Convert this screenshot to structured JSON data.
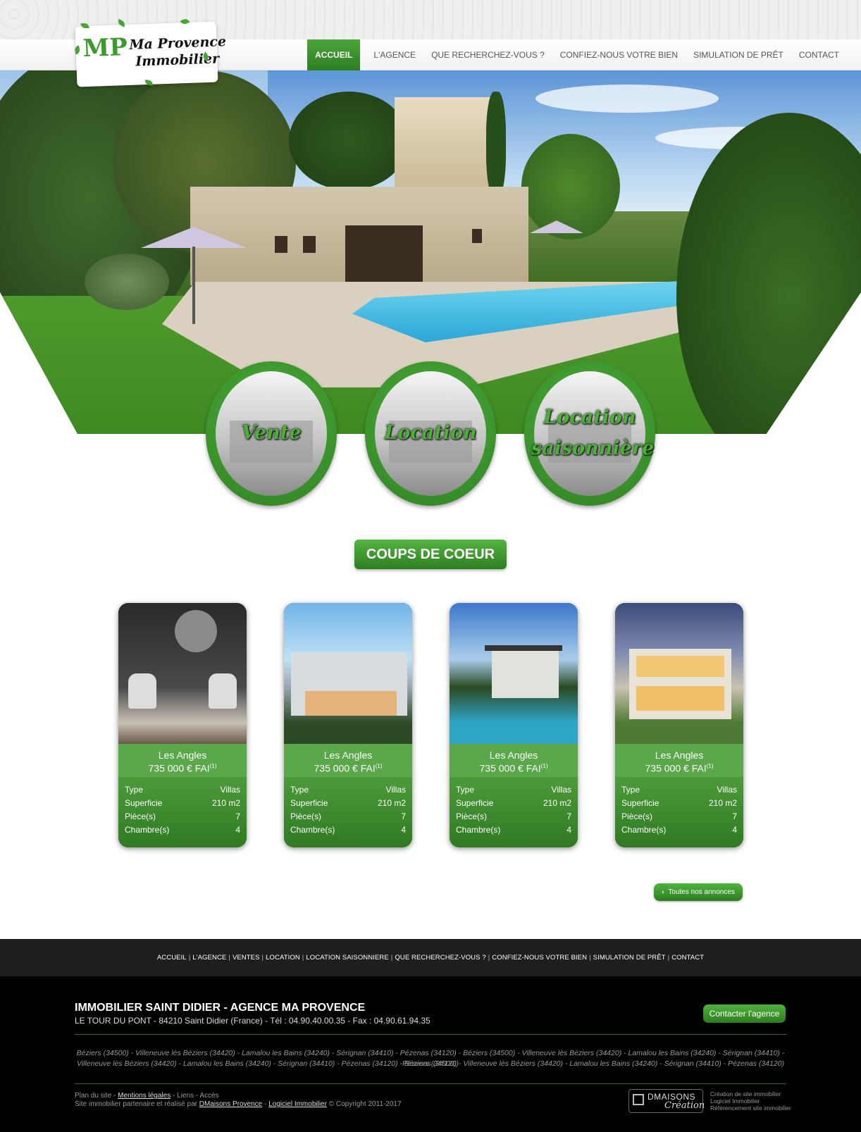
{
  "logo": {
    "line1": "Ma Provence",
    "line2": "Immobilier",
    "mark": "MP"
  },
  "nav": {
    "items": [
      "ACCUEIL",
      "L'AGENCE",
      "QUE RECHERCHEZ-VOUS ?",
      "CONFIEZ-NOUS VOTRE BIEN",
      "SIMULATION DE PRÊT",
      "CONTACT"
    ],
    "active": "ACCUEIL"
  },
  "categories": [
    "Vente",
    "Location",
    "Location saisonnière"
  ],
  "section_title": "COUPS DE COEUR",
  "listings": [
    {
      "city": "Les Angles",
      "price": "735 000 € FAI",
      "note": "(1)",
      "type_label": "Type",
      "type": "Villas",
      "surface_label": "Superficie",
      "surface": "210 m2",
      "rooms_label": "Pièce(s)",
      "rooms": "7",
      "bedrooms_label": "Chambre(s)",
      "bedrooms": "4"
    },
    {
      "city": "Les Angles",
      "price": "735 000 € FAI",
      "note": "(1)",
      "type_label": "Type",
      "type": "Villas",
      "surface_label": "Superficie",
      "surface": "210 m2",
      "rooms_label": "Pièce(s)",
      "rooms": "7",
      "bedrooms_label": "Chambre(s)",
      "bedrooms": "4"
    },
    {
      "city": "Les Angles",
      "price": "735 000 € FAI",
      "note": "(1)",
      "type_label": "Type",
      "type": "Villas",
      "surface_label": "Superficie",
      "surface": "210 m2",
      "rooms_label": "Pièce(s)",
      "rooms": "7",
      "bedrooms_label": "Chambre(s)",
      "bedrooms": "4"
    },
    {
      "city": "Les Angles",
      "price": "735 000 € FAI",
      "note": "(1)",
      "type_label": "Type",
      "type": "Villas",
      "surface_label": "Superficie",
      "surface": "210 m2",
      "rooms_label": "Pièce(s)",
      "rooms": "7",
      "bedrooms_label": "Chambre(s)",
      "bedrooms": "4"
    }
  ],
  "all_listings_button": "Toutes nos annonces",
  "footer_nav": [
    "ACCUEIL",
    "L'AGENCE",
    "VENTES",
    "LOCATION",
    "LOCATION SAISONNIERE",
    "QUE RECHERCHEZ-VOUS ?",
    "CONFIEZ-NOUS VOTRE BIEN",
    "SIMULATION DE PRÊT",
    "CONTACT"
  ],
  "footer": {
    "title": "IMMOBILIER SAINT DIDIER  - AGENCE MA PROVENCE",
    "address": "LE TOUR DU PONT - 84210 Saint Didier (France) - Tél : 04.90.40.00.35 - Fax : 04.90.61.94.35",
    "contact_button": "Contacter l'agence",
    "cities_line1": "Béziers (34500) - Villeneuve lès Béziers (34420) - Lamalou les Bains (34240) - Sérignan (34410) - Pézenas (34120) - Béziers (34500) - Villeneuve lès Béziers (34420) - Lamalou les Bains (34240) - Sérignan (34410) - Pézenas (34120)",
    "cities_line2": "Villeneuve lès Béziers (34420) - Lamalou les Bains (34240) - Sérignan (34410) - Pézenas (34120) - Béziers (34500) - Villeneuve lès Béziers (34420) - Lamalou les Bains (34240) - Sérignan (34410) - Pézenas (34120)",
    "plan": "Plan du site",
    "mentions": "Mentions légales",
    "liens": "Liens",
    "acces": "Accès",
    "partner_text": "Site immobilier partenaire et réalisé par",
    "dmaisons_link": "DMaisons Provence",
    "logiciel_link": "Logiciel Immobilier",
    "copyright": "© Copyright 2011-2017",
    "badge_top": "DMAISONS",
    "badge_bottom": "Création",
    "side_1": "Création de site immobilier",
    "side_2": "Logiciel Immobilier",
    "side_3": "Référencement site immobilier"
  },
  "colors": {
    "brand_green": "#3e9a2e",
    "footer_bg": "#000000"
  }
}
